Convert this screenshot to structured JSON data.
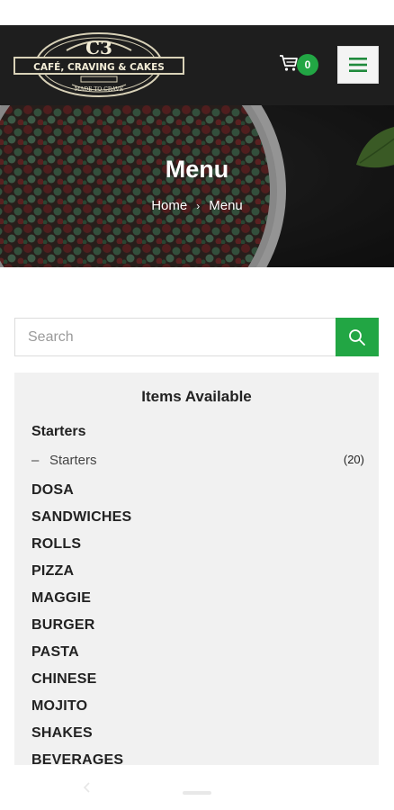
{
  "header": {
    "logo": {
      "monogram": "C3",
      "name": "CAFÉ, CRAVING & CAKES",
      "tagline": "MADE TO CRAVE"
    },
    "cart_count": "0",
    "cart_icon": "cart-icon",
    "menu_icon": "hamburger-menu-icon",
    "accent_color": "#22a644"
  },
  "hero": {
    "title": "Menu",
    "breadcrumb": {
      "home": "Home",
      "separator": "›",
      "current": "Menu"
    }
  },
  "search": {
    "placeholder": "Search",
    "value": "",
    "icon": "search-icon"
  },
  "categories_panel": {
    "title": "Items Available",
    "header": "Starters",
    "subitem": {
      "dash": "–",
      "label": "Starters",
      "count": "(20)"
    },
    "items": [
      "DOSA",
      "SANDWICHES",
      "ROLLS",
      "PIZZA",
      "MAGGIE",
      "BURGER",
      "PASTA",
      "CHINESE",
      "MOJITO",
      "SHAKES",
      "BEVERAGES"
    ]
  },
  "system_nav": {
    "back_icon": "back-chevron-icon",
    "home_icon": "home-pill-icon"
  }
}
